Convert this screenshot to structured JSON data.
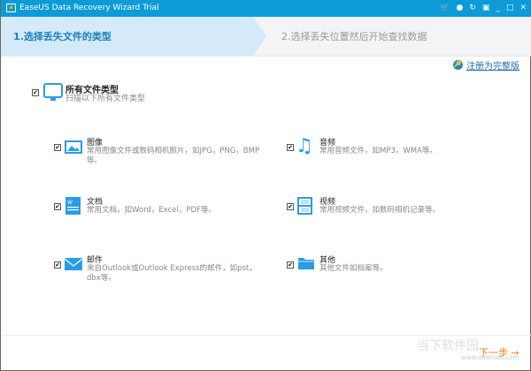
{
  "window": {
    "title": "EaseUS Data Recovery Wizard Trial"
  },
  "titlebar_icons": [
    "cart-icon",
    "chat-icon",
    "update-icon",
    "settings-icon",
    "minimize-icon",
    "maximize-icon",
    "close-icon"
  ],
  "steps": [
    {
      "label": "1.选择丢失文件的类型"
    },
    {
      "label": "2.选择丢失位置然后开始查找数据"
    }
  ],
  "register_link": "注册为完整版",
  "all_types": {
    "title": "所有文件类型",
    "subtitle": "扫描以下所有文件类型",
    "checked": true
  },
  "types": [
    {
      "title": "图像",
      "desc": "常用图像文件或数码相机照片，如JPG，PNG，BMP等。",
      "checked": true
    },
    {
      "title": "音频",
      "desc": "常用音频文件，如MP3，WMA等。",
      "checked": true
    },
    {
      "title": "文档",
      "desc": "常用文档，如Word，Excel，PDF等。",
      "checked": true
    },
    {
      "title": "视频",
      "desc": "常用视频文件，如数码相机记录等。",
      "checked": true
    },
    {
      "title": "邮件",
      "desc": "来自Outlook或Outlook Express的邮件，如pst，dbx等。",
      "checked": true
    },
    {
      "title": "其他",
      "desc": "其他文件如档案等。",
      "checked": true
    }
  ],
  "next_button": "下一步 →",
  "watermark": {
    "name": "当下软件园",
    "url": "www.downxia.com"
  },
  "colors": {
    "titlebar": "#0b9bd7",
    "accent": "#1e90e6",
    "next": "#f07b1c"
  }
}
